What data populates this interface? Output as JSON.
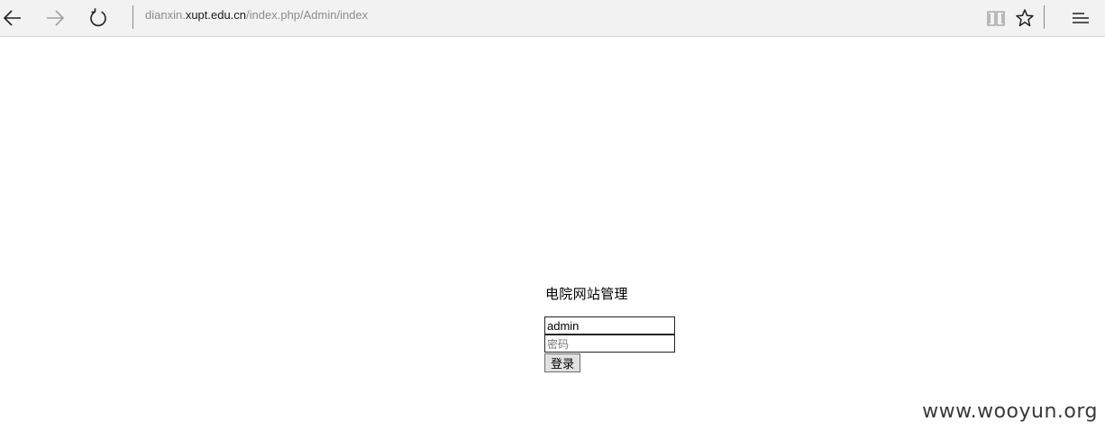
{
  "browser": {
    "address": {
      "prefix": "dianxin.",
      "host": "xupt.edu.cn",
      "path": "/index.php/Admin/index"
    },
    "icons": {
      "back": "back-arrow-icon",
      "forward": "forward-arrow-icon",
      "refresh": "refresh-icon",
      "reading_view": "reading-view-icon",
      "favorite": "star-icon",
      "hub": "hub-menu-icon"
    }
  },
  "login": {
    "title": "电院网站管理",
    "username_value": "admin",
    "password_placeholder": "密码",
    "submit_label": "登录"
  },
  "watermark": "www.wooyun.org",
  "colors": {
    "toolbar_bg": "#f2f2f2",
    "address_dim": "#8c8c8c",
    "address_host": "#1a1a1a"
  }
}
